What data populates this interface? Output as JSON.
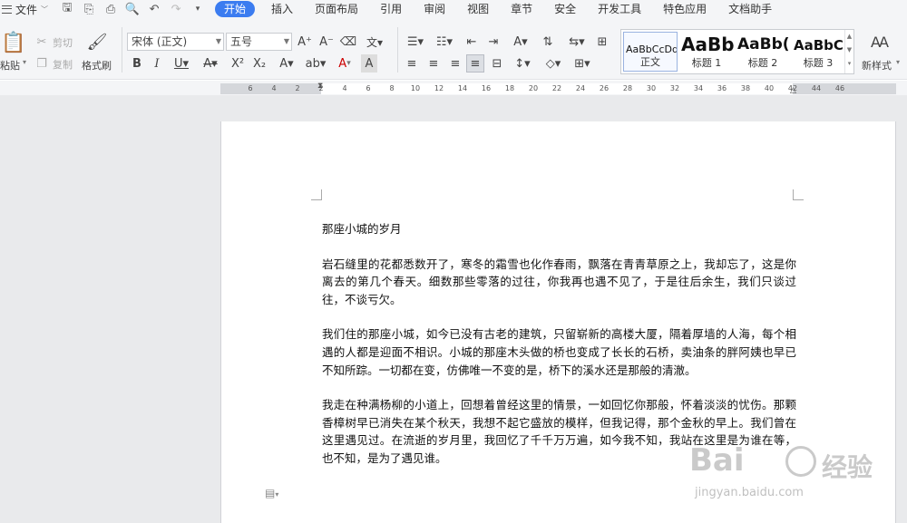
{
  "menubar": {
    "file_label": "文件",
    "tabs": [
      {
        "label": "开始",
        "active": true
      },
      {
        "label": "插入"
      },
      {
        "label": "页面布局"
      },
      {
        "label": "引用"
      },
      {
        "label": "审阅"
      },
      {
        "label": "视图"
      },
      {
        "label": "章节"
      },
      {
        "label": "安全"
      },
      {
        "label": "开发工具"
      },
      {
        "label": "特色应用"
      },
      {
        "label": "文档助手"
      }
    ],
    "accent_color": "#3b7cf0"
  },
  "ribbon": {
    "paste_label": "粘贴",
    "cut_label": "剪切",
    "copy_label": "复制",
    "format_painter_label": "格式刷",
    "font_name": "宋体 (正文)",
    "font_size": "五号",
    "styles": [
      {
        "preview": "AaBbCcDd",
        "name": "正文"
      },
      {
        "preview": "AaBb",
        "name": "标题 1"
      },
      {
        "preview": "AaBb(",
        "name": "标题 2"
      },
      {
        "preview": "AaBbC",
        "name": "标题 3"
      }
    ],
    "new_style_label": "新样式"
  },
  "ruler": {
    "ticks": [
      "6",
      "4",
      "2",
      "2",
      "4",
      "6",
      "8",
      "10",
      "12",
      "14",
      "16",
      "18",
      "20",
      "22",
      "24",
      "26",
      "28",
      "30",
      "32",
      "34",
      "36",
      "38",
      "40",
      "42",
      "44",
      "46"
    ]
  },
  "document": {
    "title": "那座小城的岁月",
    "paragraphs": [
      "岩石缝里的花都悉数开了，寒冬的霜雪也化作春雨，飘落在青青草原之上，我却忘了，这是你离去的第几个春天。细数那些零落的过往，你我再也遇不见了，于是往后余生，我们只谈过往，不谈亏欠。",
      "我们住的那座小城，如今已没有古老的建筑，只留崭新的高楼大厦，隔着厚墙的人海，每个相遇的人都是迎面不相识。小城的那座木头做的桥也变成了长长的石桥，卖油条的胖阿姨也早已不知所踪。一切都在变，仿佛唯一不变的是，桥下的溪水还是那般的清澈。",
      "我走在种满杨柳的小道上，回想着曾经这里的情景，一如回忆你那般，怀着淡淡的忧伤。那颗香樟树早已消失在某个秋天，我想不起它盛放的模样，但我记得，那个金秋的早上。我们曾在这里遇见过。在流逝的岁月里，我回忆了千千万万遍，如今我不知，我站在这里是为谁在等，也不知，是为了遇见谁。"
    ]
  },
  "watermark": {
    "logo": "Bai",
    "logo_cn": "经验",
    "url": "jingyan.baidu.com"
  }
}
